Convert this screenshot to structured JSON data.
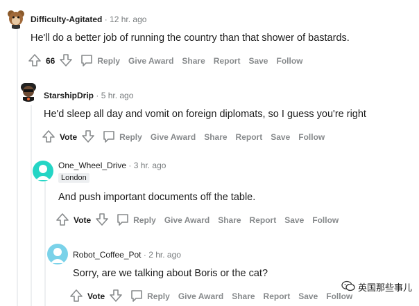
{
  "comments": [
    {
      "username": "Difficulty-Agitated",
      "time": "12 hr. ago",
      "flair": "",
      "body": "He'll do a better job of running the country than that shower of bastards.",
      "vote": "66",
      "reply": "Reply",
      "award": "Give Award",
      "share": "Share",
      "report": "Report",
      "save": "Save",
      "follow": "Follow"
    },
    {
      "username": "StarshipDrip",
      "time": "5 hr. ago",
      "flair": "",
      "body": "He'd sleep all day and vomit on foreign diplomats, so I guess you're right",
      "vote": "Vote",
      "reply": "Reply",
      "award": "Give Award",
      "share": "Share",
      "report": "Report",
      "save": "Save",
      "follow": "Follow"
    },
    {
      "username": "One_Wheel_Drive",
      "time": "3 hr. ago",
      "flair": "London",
      "body": "And push important documents off the table.",
      "vote": "Vote",
      "reply": "Reply",
      "award": "Give Award",
      "share": "Share",
      "report": "Report",
      "save": "Save",
      "follow": "Follow"
    },
    {
      "username": "Robot_Coffee_Pot",
      "time": "2 hr. ago",
      "flair": "",
      "body": "Sorry, are we talking about Boris or the cat?",
      "vote": "Vote",
      "reply": "Reply",
      "award": "Give Award",
      "share": "Share",
      "report": "Report",
      "save": "Save",
      "follow": "Follow"
    }
  ],
  "separator": "·",
  "watermark": {
    "text": "英国那些事儿",
    "icon": "wechat-icon"
  },
  "colors": {
    "meta_gray": "#787c7e",
    "action_gray": "#878a8c",
    "avatar_teal": "#24d5c5",
    "avatar_cyan": "#7ad2e9"
  }
}
